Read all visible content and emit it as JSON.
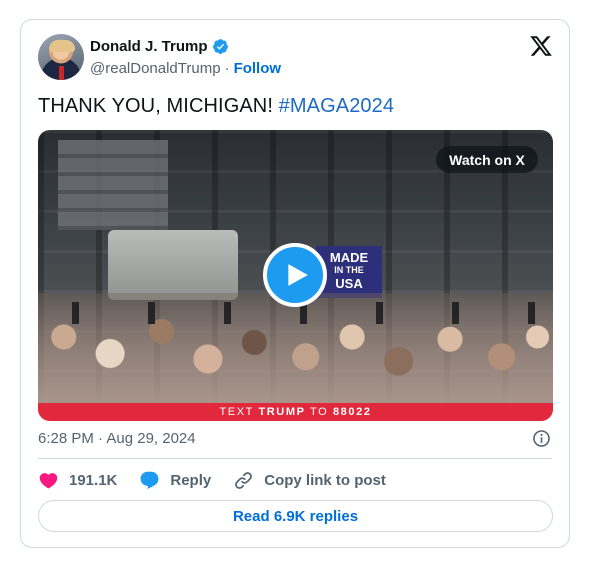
{
  "author": {
    "name": "Donald J. Trump",
    "handle": "@realDonaldTrump",
    "separator": "·",
    "follow_label": "Follow",
    "verified": true
  },
  "brand": {
    "logo": "x-logo-icon"
  },
  "tweet": {
    "text": "THANK YOU, MICHIGAN!",
    "hashtag": "#MAGA2024"
  },
  "media": {
    "type": "video",
    "watch_on_label": "Watch on X",
    "banner_lines": [
      "MADE",
      "IN THE",
      "USA"
    ],
    "bottom_bar": {
      "prefix": "TEXT",
      "keyword": "TRUMP",
      "middle": "TO",
      "number": "88022"
    }
  },
  "meta": {
    "timestamp": "6:28 PM · Aug 29, 2024"
  },
  "actions": {
    "likes": "191.1K",
    "reply_label": "Reply",
    "copy_link_label": "Copy link to post"
  },
  "read_replies_label": "Read 6.9K replies",
  "colors": {
    "link": "#006fd6",
    "hashtag": "#1d6ac7",
    "like": "#f91880",
    "reply": "#1d9bf0",
    "play": "#1d9bf0",
    "text_bar": "#e2283d",
    "verified": "#1d9bf0"
  }
}
